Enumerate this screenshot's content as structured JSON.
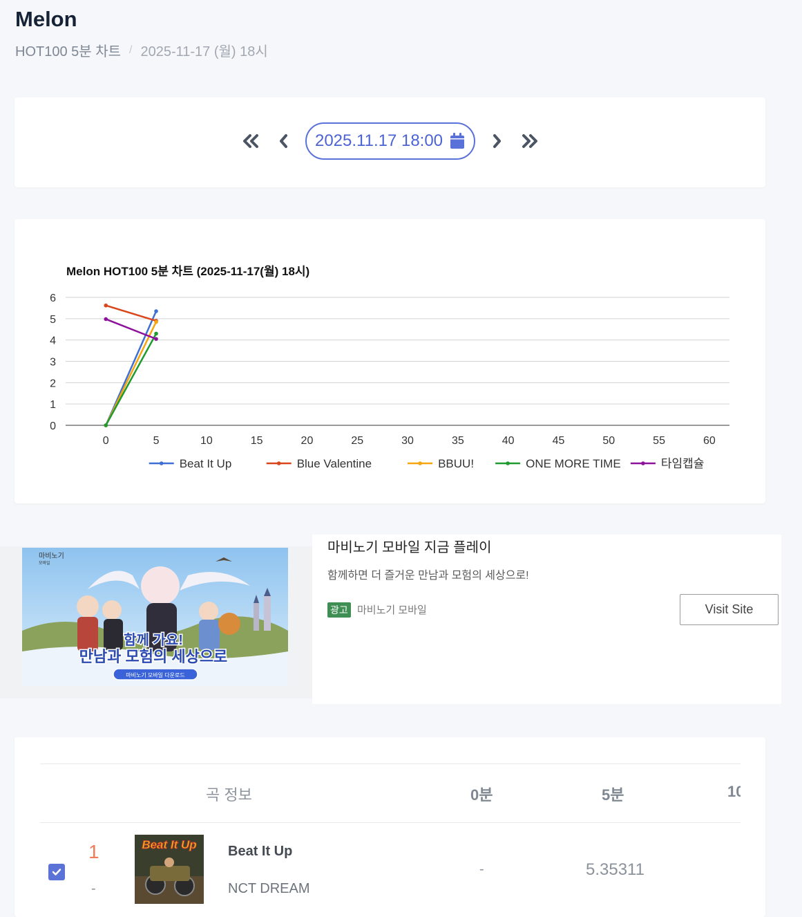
{
  "header": {
    "title": "Melon",
    "breadcrumb": [
      "HOT100 5분 차트",
      "2025-11-17 (월) 18시"
    ]
  },
  "date_nav": {
    "current": "2025.11.17 18:00"
  },
  "chart_data": {
    "type": "line",
    "title": "Melon HOT100 5분 차트 (2025-11-17(월) 18시)",
    "xlabel": "",
    "ylabel": "",
    "x_ticks": [
      0,
      5,
      10,
      15,
      20,
      25,
      30,
      35,
      40,
      45,
      50,
      55,
      60
    ],
    "y_ticks": [
      0,
      1,
      2,
      3,
      4,
      5,
      6
    ],
    "xlim": [
      -4,
      62
    ],
    "ylim": [
      0,
      6
    ],
    "legend_position": "bottom",
    "grid": true,
    "series": [
      {
        "name": "Beat It Up",
        "color": "#3f6fd0",
        "x": [
          0,
          5
        ],
        "y": [
          0,
          5.35
        ]
      },
      {
        "name": "Blue Valentine",
        "color": "#d9461c",
        "x": [
          0,
          5
        ],
        "y": [
          5.62,
          4.9
        ]
      },
      {
        "name": "BBUU!",
        "color": "#f5a50f",
        "x": [
          0,
          5
        ],
        "y": [
          0,
          4.85
        ]
      },
      {
        "name": "ONE MORE TIME",
        "color": "#1f9a2e",
        "x": [
          0,
          5
        ],
        "y": [
          0,
          4.3
        ]
      },
      {
        "name": "타임캡슐",
        "color": "#8d119c",
        "x": [
          0,
          5
        ],
        "y": [
          4.98,
          4.05
        ]
      }
    ]
  },
  "ad": {
    "title": "마비노기 모바일 지금 플레이",
    "description": "함께하면 더 즐거운 만남과 모험의 세상으로!",
    "badge": "광고",
    "advertiser": "마비노기 모바일",
    "cta": "Visit Site",
    "image": {
      "logo": "마비노기",
      "logo_sub": "모바일",
      "headline1": "함께 가요!",
      "headline2": "만남과 모험의 세상으로",
      "button": "마비노기 모바일 다운로드"
    }
  },
  "table": {
    "headers": [
      "곡 정보",
      "0분",
      "5분",
      "10"
    ],
    "rows": [
      {
        "checked": true,
        "rank": "1",
        "change": "-",
        "album_art_text": "Beat It Up",
        "title": "Beat It Up",
        "artist": "NCT DREAM",
        "m0": "-",
        "m5": "5.35311"
      }
    ]
  }
}
